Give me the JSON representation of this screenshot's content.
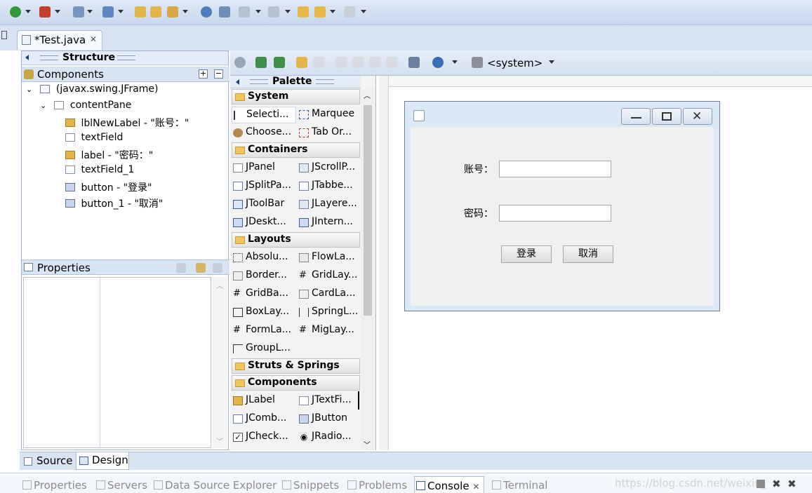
{
  "editor": {
    "tab_title": "*Test.java"
  },
  "structure": {
    "title": "Structure",
    "components_title": "Components",
    "tree": [
      {
        "label": "(javax.swing.JFrame)",
        "icon": "jframe-icon"
      },
      {
        "label": "contentPane",
        "icon": "panel-icon"
      },
      {
        "label": "lblNewLabel - \"账号：\"",
        "icon": "label-icon"
      },
      {
        "label": "textField",
        "icon": "textfield-icon"
      },
      {
        "label": "label - \"密码：\"",
        "icon": "label-icon"
      },
      {
        "label": "textField_1",
        "icon": "textfield-icon"
      },
      {
        "label": "button - \"登录\"",
        "icon": "button-icon"
      },
      {
        "label": "button_1 - \"取消\"",
        "icon": "button-icon"
      }
    ],
    "properties_title": "Properties"
  },
  "design_toolbar": {
    "system_label": "<system>"
  },
  "palette": {
    "title": "Palette",
    "categories": {
      "system": "System",
      "containers": "Containers",
      "layouts": "Layouts",
      "struts": "Struts & Springs",
      "components": "Components"
    },
    "items": {
      "selection": "Selecti...",
      "marquee": "Marquee",
      "choose": "Choose...",
      "tab_order": "Tab Or...",
      "jpanel": "JPanel",
      "jscroll": "JScrollP...",
      "jsplit": "JSplitPa...",
      "jtabbed": "JTabbe...",
      "jtoolbar": "JToolBar",
      "jlayered": "JLayere...",
      "jdesktop": "JDeskt...",
      "jinternal": "JIntern...",
      "absolute": "Absolu...",
      "flow": "FlowLa...",
      "border": "Border...",
      "grid": "GridLay...",
      "gridbag": "GridBa...",
      "card": "CardLa...",
      "box": "BoxLay...",
      "spring": "SpringL...",
      "form": "FormLa...",
      "mig": "MigLay...",
      "group": "GroupL...",
      "jlabel": "JLabel",
      "jtextfield": "JTextFi...",
      "jcombo": "JComb...",
      "jbutton": "JButton",
      "jcheck": "JCheck...",
      "jradio": "JRadio..."
    }
  },
  "form": {
    "account_label": "账号：",
    "password_label": "密码：",
    "login_button": "登录",
    "cancel_button": "取消"
  },
  "bottom_tabs": {
    "source": "Source",
    "design": "Design"
  },
  "views": {
    "properties": "Properties",
    "servers": "Servers",
    "datasource": "Data Source Explorer",
    "snippets": "Snippets",
    "problems": "Problems",
    "console": "Console",
    "terminal": "Terminal"
  },
  "watermark": "https://blog.csdn.net/weixin_"
}
